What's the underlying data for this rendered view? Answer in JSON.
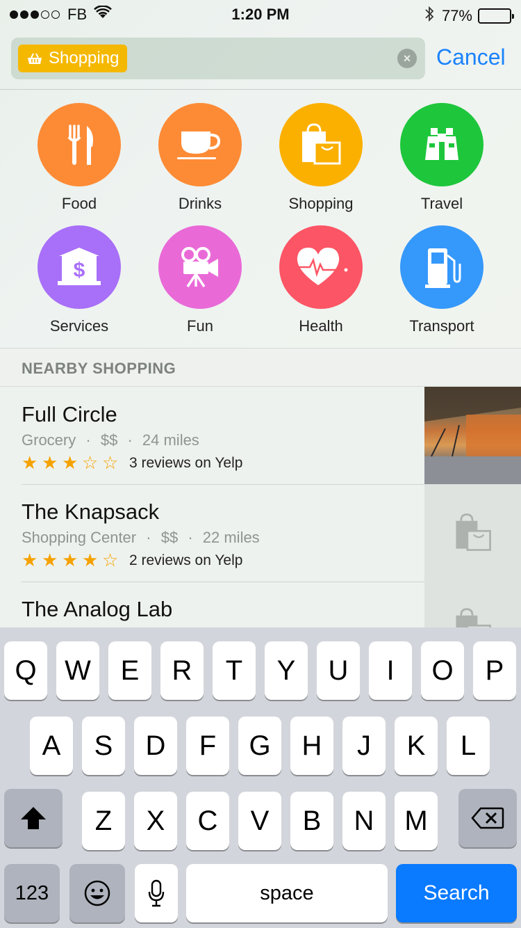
{
  "status_bar": {
    "carrier": "FB",
    "time": "1:20 PM",
    "battery": "77%",
    "battery_level": 0.77
  },
  "search": {
    "token_label": "Shopping",
    "cancel_label": "Cancel"
  },
  "categories": [
    {
      "label": "Food",
      "color": "#fd8b36"
    },
    {
      "label": "Drinks",
      "color": "#fd8b36"
    },
    {
      "label": "Shopping",
      "color": "#fbb000"
    },
    {
      "label": "Travel",
      "color": "#1ec63c"
    },
    {
      "label": "Services",
      "color": "#a86ff8"
    },
    {
      "label": "Fun",
      "color": "#e96ad7"
    },
    {
      "label": "Health",
      "color": "#fc5565"
    },
    {
      "label": "Transport",
      "color": "#3598fb"
    }
  ],
  "section_header": "NEARBY SHOPPING",
  "results": [
    {
      "title": "Full Circle",
      "category": "Grocery",
      "price": "$$",
      "distance": "24 miles",
      "rating": 3,
      "reviews": "3 reviews on Yelp",
      "thumb": "photo"
    },
    {
      "title": "The Knapsack",
      "category": "Shopping Center",
      "price": "$$",
      "distance": "22 miles",
      "rating": 4,
      "reviews": "2 reviews on Yelp",
      "thumb": "shopping-bag-icon"
    },
    {
      "title": "The Analog Lab",
      "category": "",
      "price": "",
      "distance": "",
      "rating": 0,
      "reviews": "",
      "thumb": "shopping-bag-icon"
    }
  ],
  "keyboard": {
    "row1": [
      "Q",
      "W",
      "E",
      "R",
      "T",
      "Y",
      "U",
      "I",
      "O",
      "P"
    ],
    "row2": [
      "A",
      "S",
      "D",
      "F",
      "G",
      "H",
      "J",
      "K",
      "L"
    ],
    "row3": [
      "Z",
      "X",
      "C",
      "V",
      "B",
      "N",
      "M"
    ],
    "numbers_label": "123",
    "space_label": "space",
    "search_label": "Search"
  },
  "colors": {
    "accent": "#1a82fb",
    "star": "#f5a200",
    "search_key": "#0a7aff"
  }
}
